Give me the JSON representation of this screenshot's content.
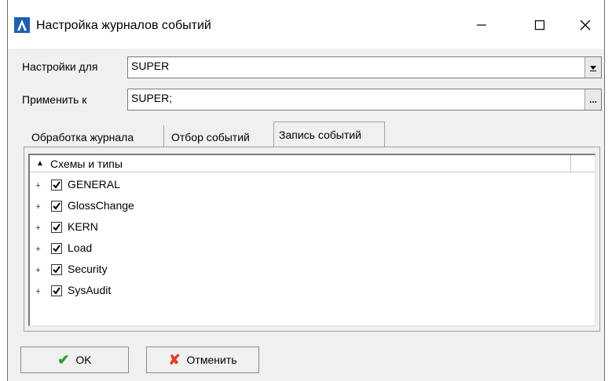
{
  "window": {
    "title": "Настройка журналов событий"
  },
  "form": {
    "settings_label": "Настройки для",
    "settings_value": "SUPER",
    "apply_label": "Применить к",
    "apply_value": "SUPER;",
    "browse_label": "..."
  },
  "tabs": [
    {
      "label": "Обработка журнала"
    },
    {
      "label": "Отбор событий"
    },
    {
      "label": "Запись событий",
      "active": true
    }
  ],
  "tree": {
    "header": "Схемы и типы",
    "items": [
      {
        "label": "GENERAL",
        "checked": true
      },
      {
        "label": "GlossChange",
        "checked": true
      },
      {
        "label": "KERN",
        "checked": true
      },
      {
        "label": "Load",
        "checked": true
      },
      {
        "label": "Security",
        "checked": true
      },
      {
        "label": "SysAudit",
        "checked": true
      }
    ]
  },
  "buttons": {
    "ok": "OK",
    "cancel": "Отменить"
  },
  "colors": {
    "ok_check": "#2e9d2e",
    "cancel_x": "#e0402a",
    "app_icon_bg": "#1e5fb4"
  }
}
